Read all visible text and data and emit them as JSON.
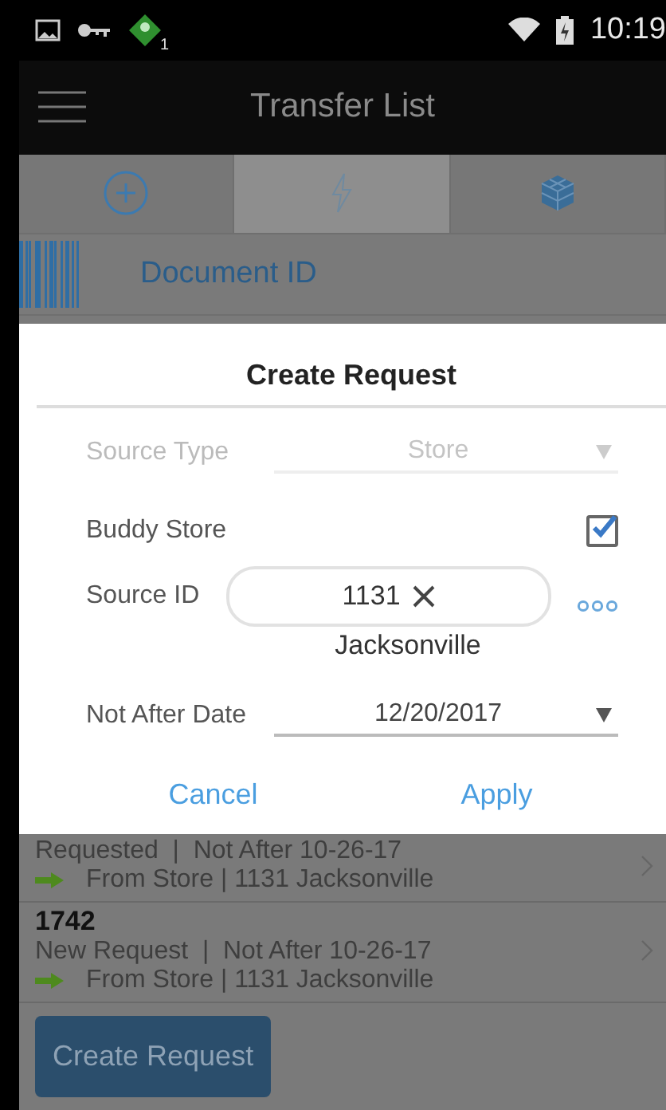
{
  "status_bar": {
    "notification_count": "1",
    "time": "10:19"
  },
  "app_bar": {
    "title": "Transfer List"
  },
  "toolbar": {
    "tabs": [
      {
        "kind": "add",
        "selected": false
      },
      {
        "kind": "bolt",
        "selected": true
      },
      {
        "kind": "cube",
        "selected": false
      }
    ]
  },
  "scan_field": {
    "placeholder": "Document ID"
  },
  "dialog": {
    "title": "Create Request",
    "fields": [
      {
        "kind": "dropdown",
        "label": "Source Type",
        "value": "Store",
        "disabled": true
      },
      {
        "kind": "checkbox",
        "label": "Buddy Store",
        "checked": true
      },
      {
        "kind": "search",
        "label": "Source ID",
        "value": "1131",
        "caption": "Jacksonville"
      },
      {
        "kind": "dropdown",
        "label": "Not After Date",
        "value": "12/20/2017",
        "disabled": false
      }
    ],
    "buttons": [
      "Cancel",
      "Apply"
    ]
  },
  "transfers": [
    {
      "summary": "Requested  |  Not After 10-26-17",
      "source": "From Store | 1131 Jacksonville"
    },
    {
      "id": "1742",
      "summary": "New Request  |  Not After 10-26-17",
      "source": "From Store | 1131 Jacksonville"
    }
  ],
  "footer_button": "Create Request"
}
